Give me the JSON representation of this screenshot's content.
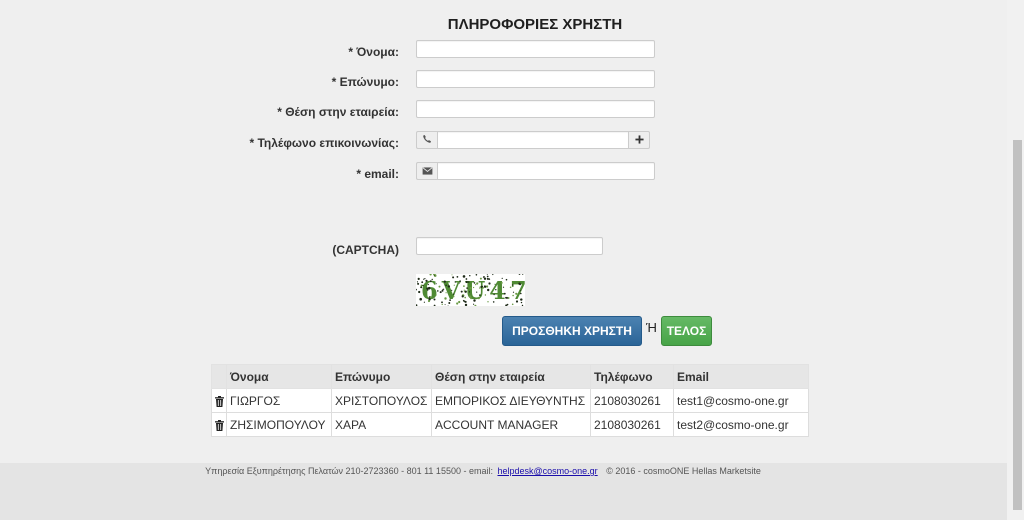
{
  "page": {
    "title": "ΠΛΗΡΟΦΟΡΙΕΣ ΧΡΗΣΤΗ"
  },
  "form": {
    "first_name": {
      "label": "* Όνομα:",
      "value": ""
    },
    "last_name": {
      "label": "* Επώνυμο:",
      "value": ""
    },
    "position": {
      "label": "* Θέση στην εταιρεία:",
      "value": ""
    },
    "phone": {
      "label": "* Τηλέφωνο επικοινωνίας:",
      "value": "",
      "addon_icon": "phone-icon",
      "add_icon": "plus-icon"
    },
    "email": {
      "label": "* email:",
      "value": "",
      "addon_icon": "envelope-icon"
    },
    "captcha": {
      "label": "(CAPTCHA)",
      "value": "",
      "image_text": "6VU47"
    },
    "add_user_label": "ΠΡΟΣΘΗΚΗ ΧΡΗΣΤΗ",
    "or_label": "Ή",
    "finish_label": "ΤΕΛΟΣ"
  },
  "users_table": {
    "columns": [
      "Όνομα",
      "Επώνυμο",
      "Θέση στην εταιρεία",
      "Τηλέφωνο",
      "Email"
    ],
    "rows": [
      {
        "action_icon": "trash-icon",
        "first_name": "ΓΙΩΡΓΟΣ",
        "last_name": "ΧΡΙΣΤΟΠΟΥΛΟΣ",
        "position": "ΕΜΠΟΡΙΚΟΣ ΔΙΕΥΘΥΝΤΗΣ",
        "phone": "2108030261",
        "email": "test1@cosmo-one.gr"
      },
      {
        "action_icon": "trash-icon",
        "first_name": "ΖΗΣΙΜΟΠΟΥΛΟΥ",
        "last_name": "ΧΑΡΑ",
        "position": "ACCOUNT MANAGER",
        "phone": "2108030261",
        "email": "test2@cosmo-one.gr"
      }
    ]
  },
  "footer": {
    "service_text": "Υπηρεσία Εξυπηρέτησης Πελατών 210-2723360 - 801 11 15500 - email:",
    "helpdesk_link": "helpdesk@cosmo-one.gr",
    "copyright": "© 2016 - cosmoONE Hellas Marketsite"
  },
  "colors": {
    "page_background": "#efefef",
    "footer_background": "#e4e4e4",
    "primary_button": "#2e6da4",
    "success_button": "#4cae4c",
    "link": "#1a0dab"
  }
}
